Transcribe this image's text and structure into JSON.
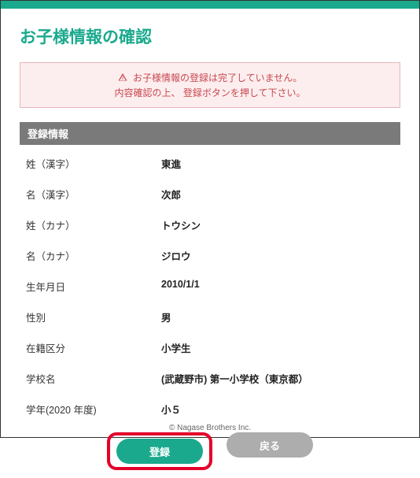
{
  "title": "お子様情報の確認",
  "alert": {
    "line1": "お子様情報の登録は完了していません。",
    "line2": "内容確認の上、 登録ボタンを押して下さい。"
  },
  "section_header": "登録情報",
  "fields": [
    {
      "label": "姓（漢字）",
      "value": "東進"
    },
    {
      "label": "名（漢字）",
      "value": "次郎"
    },
    {
      "label": "姓（カナ）",
      "value": "トウシン"
    },
    {
      "label": "名（カナ）",
      "value": "ジロウ"
    },
    {
      "label": "生年月日",
      "value": "2010/1/1"
    },
    {
      "label": "性別",
      "value": "男"
    },
    {
      "label": "在籍区分",
      "value": "小学生"
    },
    {
      "label": "学校名",
      "value": "(武蔵野市) 第一小学校（東京都）"
    },
    {
      "label": "学年(2020 年度)",
      "value": "小５"
    }
  ],
  "buttons": {
    "register": "登録",
    "back": "戻る"
  },
  "footer": "© Nagase Brothers Inc."
}
